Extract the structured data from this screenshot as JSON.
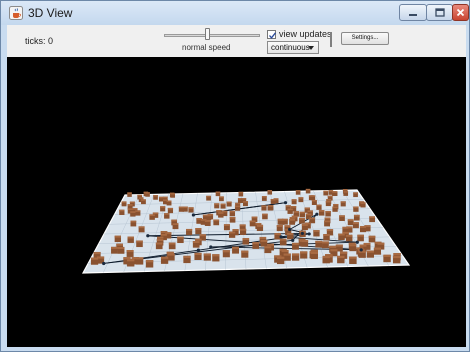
{
  "window": {
    "title": "3D View",
    "app_icon": "java-cup-icon",
    "buttons": [
      "minimize-icon",
      "maximize-icon",
      "close-icon"
    ]
  },
  "toolbar": {
    "ticks_label": "ticks: 0",
    "speed_label": "normal speed",
    "speed_value": 0.5,
    "view_updates_label": "view updates",
    "view_updates_checked": true,
    "update_mode": "continuous",
    "settings_label": "Settings..."
  },
  "scene": {
    "background": "#000000",
    "floor_color": "#d9e3ec",
    "grid_color": "#b8c6d3",
    "turtle_color": "#8a5230",
    "link_color": "#0d1a2a"
  }
}
